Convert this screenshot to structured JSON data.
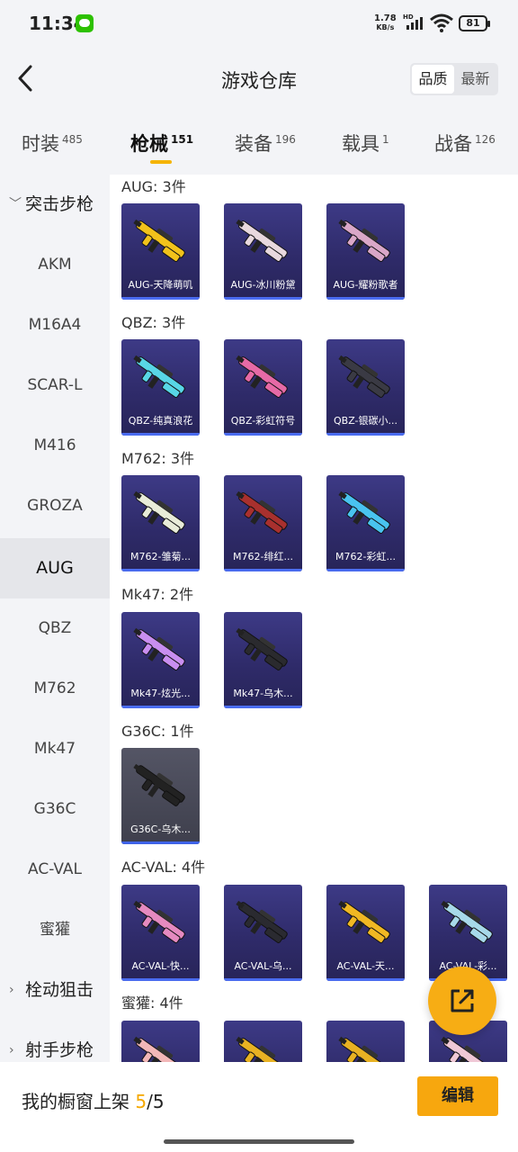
{
  "status_bar": {
    "time": "11:34",
    "net_speed_value": "1.78",
    "net_speed_unit": "KB/s",
    "net_type": "HD",
    "battery": "81"
  },
  "header": {
    "title": "游戏仓库",
    "sort_options": [
      "品质",
      "最新"
    ],
    "active_sort": "品质"
  },
  "tabs": [
    {
      "label": "时装",
      "count": "485"
    },
    {
      "label": "枪械",
      "count": "151",
      "active": true
    },
    {
      "label": "装备",
      "count": "196"
    },
    {
      "label": "载具",
      "count": "1"
    },
    {
      "label": "战备",
      "count": "126"
    }
  ],
  "sidebar": {
    "group_assault": "突击步枪",
    "items": [
      "AKM",
      "M16A4",
      "SCAR-L",
      "M416",
      "GROZA",
      "AUG",
      "QBZ",
      "M762",
      "Mk47",
      "G36C",
      "AC-VAL",
      "蜜獾"
    ],
    "selected": "AUG",
    "group_bolt": "栓动狙击",
    "group_marksman": "射手步枪"
  },
  "sections": [
    {
      "title": "AUG: 3件",
      "items": [
        "AUG-天降萌叽",
        "AUG-冰川粉黛",
        "AUG-耀粉歌者"
      ]
    },
    {
      "title": "QBZ: 3件",
      "items": [
        "QBZ-纯真浪花",
        "QBZ-彩虹符号",
        "QBZ-银碳小..."
      ]
    },
    {
      "title": "M762: 3件",
      "items": [
        "M762-雏菊...",
        "M762-绯红...",
        "M762-彩虹..."
      ]
    },
    {
      "title": "Mk47: 2件",
      "items": [
        "Mk47-炫光...",
        "Mk47-乌木..."
      ]
    },
    {
      "title": "G36C: 1件",
      "items": [
        "G36C-乌木..."
      ]
    },
    {
      "title": "AC-VAL: 4件",
      "items": [
        "AC-VAL-快...",
        "AC-VAL-乌...",
        "AC-VAL-天...",
        "AC-VAL-彩..."
      ]
    },
    {
      "title": "蜜獾: 4件",
      "items": [
        "",
        "",
        "",
        ""
      ]
    }
  ],
  "gun_colors": {
    "aug": [
      "#f2c21b",
      "#e8d8de",
      "#d9a7c8"
    ],
    "qbz": [
      "#58d6e6",
      "#e66aa6",
      "#3a3a44"
    ],
    "m762": [
      "#e8ecd8",
      "#a8302e",
      "#49c3ef"
    ],
    "mk47": [
      "#c98ef0",
      "#2a2a2e"
    ],
    "g36c": [
      "#222222"
    ],
    "acval": [
      "#e58ac0",
      "#2a2a30",
      "#f0b823",
      "#a7d9e9"
    ],
    "honey": [
      "#f2b7b8",
      "#e8b223",
      "#e8b223",
      "#f0c8d6"
    ]
  },
  "footer": {
    "label_prefix": "我的橱窗上架 ",
    "current": "5",
    "total": "/5",
    "edit_label": "编辑"
  }
}
